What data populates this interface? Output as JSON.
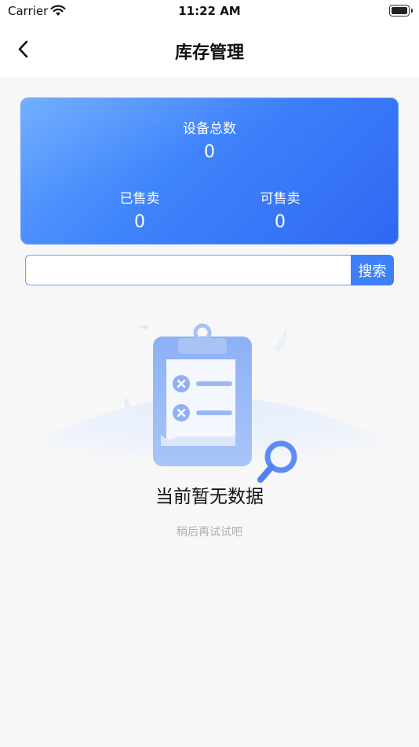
{
  "status_bar": {
    "carrier": "Carrier",
    "time": "11:22 AM"
  },
  "nav": {
    "title": "库存管理"
  },
  "summary": {
    "total_label": "设备总数",
    "total_value": "0",
    "sold_label": "已售卖",
    "sold_value": "0",
    "available_label": "可售卖",
    "available_value": "0"
  },
  "search": {
    "value": "",
    "placeholder": "",
    "button_label": "搜索"
  },
  "empty_state": {
    "title": "当前暂无数据",
    "subtitle": "稍后再试试吧"
  },
  "colors": {
    "accent": "#3f7ff7",
    "card_start": "#5fa4ff",
    "card_end": "#2f68f3"
  }
}
